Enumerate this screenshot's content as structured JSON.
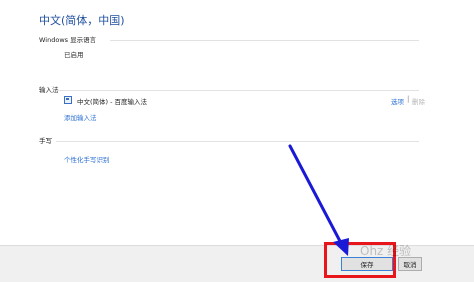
{
  "page": {
    "title": "中文(简体，中国)"
  },
  "display_language": {
    "label": "Windows 显示语言",
    "status": "已启用"
  },
  "input_method": {
    "label": "输入法",
    "items": [
      {
        "name": "中文(简体) - 百度输入法",
        "options_label": "选项",
        "separator": "|",
        "remove_label": "删除"
      }
    ],
    "add_label": "添加输入法"
  },
  "handwriting": {
    "label": "手写",
    "personalize_label": "个性化手写识别"
  },
  "footer": {
    "save_label": "保存",
    "cancel_label": "取消"
  },
  "overlay": {
    "watermark_text": "Ohz 经验",
    "highlight_color": "#e8161b",
    "arrow_color": "#1a1ad6"
  }
}
